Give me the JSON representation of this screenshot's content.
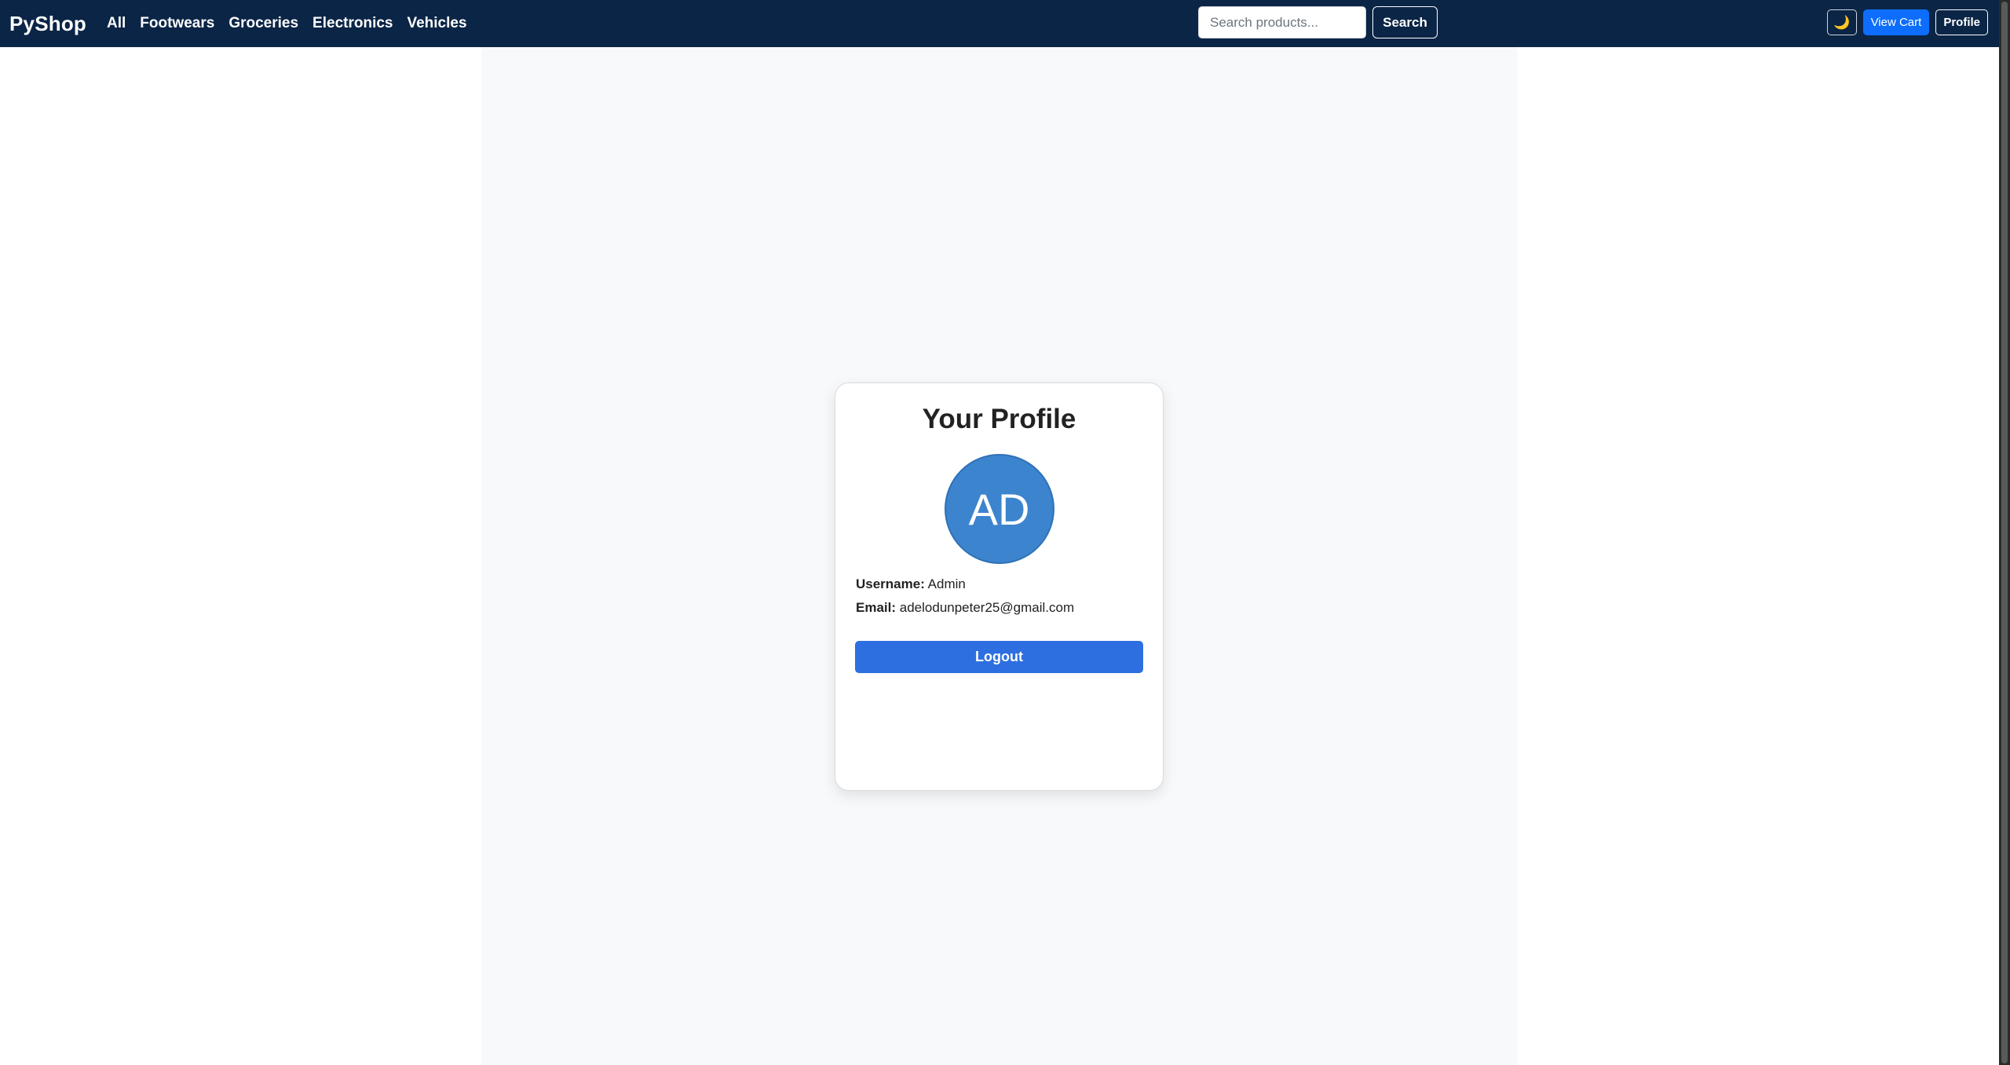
{
  "navbar": {
    "brand": "PyShop",
    "links": [
      "All",
      "Footwears",
      "Groceries",
      "Electronics",
      "Vehicles"
    ],
    "search": {
      "placeholder": "Search products...",
      "value": "",
      "button_label": "Search"
    },
    "theme_toggle_icon": "moon-icon",
    "theme_toggle_glyph": "🌙",
    "cart_label": "View Cart",
    "profile_label": "Profile"
  },
  "profile": {
    "title": "Your Profile",
    "avatar_initials": "AD",
    "username_label": "Username:",
    "username": "Admin",
    "email_label": "Email:",
    "email": "adelodunpeter25@gmail.com",
    "logout_label": "Logout"
  },
  "colors": {
    "navbar_bg": "#0b2546",
    "accent": "#0d6efd",
    "logout_bg": "#2d6fe0",
    "avatar_bg": "#3d84ce"
  }
}
